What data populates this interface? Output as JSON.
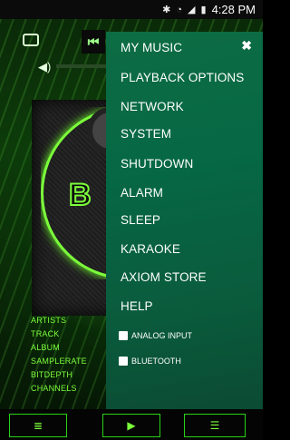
{
  "status": {
    "icons": [
      "bluetooth-icon",
      "wifi-icon",
      "signal-icon",
      "battery-icon"
    ],
    "time": "4:28 PM"
  },
  "player": {
    "prev_icon": "skip-previous-icon",
    "meta_labels": [
      "ARTISTS",
      "TRACK",
      "ALBUM",
      "SAMPLERATE",
      "BITDEPTH",
      "CHANNELS"
    ],
    "accent_color": "#7cff3b"
  },
  "menu": {
    "close_icon": "close-icon",
    "items": [
      "MY MUSIC",
      "PLAYBACK OPTIONS",
      "NETWORK",
      "SYSTEM",
      "SHUTDOWN",
      "ALARM",
      "SLEEP",
      "KARAOKE",
      "AXIOM STORE",
      "HELP"
    ],
    "checkboxes": [
      {
        "label": "ANALOG INPUT",
        "checked": false
      },
      {
        "label": "BLUETOOTH",
        "checked": false
      }
    ],
    "background_color": "#086a45"
  },
  "bottom_bar": {
    "buttons": [
      "queue-icon",
      "play-icon",
      "list-icon"
    ]
  }
}
